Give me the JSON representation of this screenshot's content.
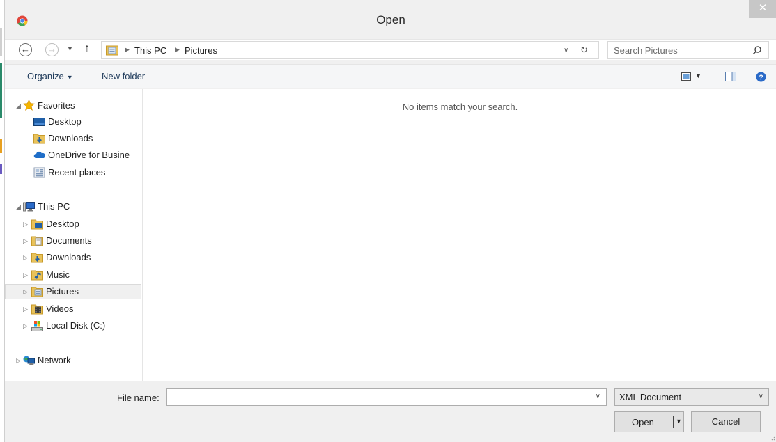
{
  "window": {
    "title": "Open",
    "close_symbol": "✕"
  },
  "address": {
    "crumbs": [
      "This PC",
      "Pictures"
    ],
    "search_placeholder": "Search Pictures"
  },
  "toolbar": {
    "organize_label": "Organize",
    "new_folder_label": "New folder"
  },
  "navpane": {
    "favorites": {
      "label": "Favorites",
      "items": [
        "Desktop",
        "Downloads",
        "OneDrive for Busine",
        "Recent places"
      ]
    },
    "this_pc": {
      "label": "This PC",
      "items": [
        "Desktop",
        "Documents",
        "Downloads",
        "Music",
        "Pictures",
        "Videos",
        "Local Disk (C:)"
      ],
      "selected": "Pictures"
    },
    "network": {
      "label": "Network"
    }
  },
  "content": {
    "empty_message": "No items match your search."
  },
  "bottom": {
    "file_name_label": "File name:",
    "file_name_value": "",
    "file_type_value": "XML Document",
    "open_label": "Open",
    "cancel_label": "Cancel"
  },
  "colors": {
    "folder_yellow": "#e8c25a",
    "link_blue": "#1e3a5a",
    "star_gold": "#f4b400"
  }
}
